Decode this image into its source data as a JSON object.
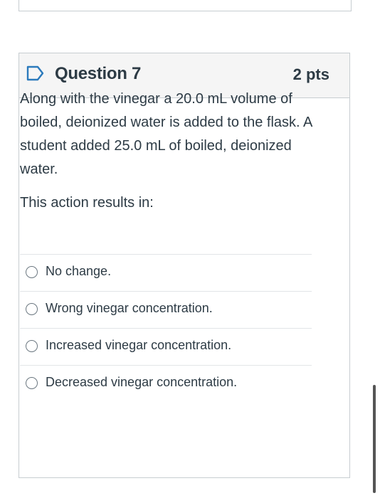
{
  "question": {
    "title": "Question 7",
    "points": "2 pts",
    "text": "Along with the vinegar a 20.0 mL volume of boiled, deionized water is added to the flask. A student added 25.0 mL of boiled, deionized water.",
    "prompt": "This action results in:",
    "answers": [
      {
        "label": "No change."
      },
      {
        "label": "Wrong vinegar concentration."
      },
      {
        "label": "Increased vinegar concentration."
      },
      {
        "label": "Decreased vinegar concentration."
      }
    ]
  },
  "icons": {
    "flag": "flag-question-icon"
  },
  "colors": {
    "header_bg": "#f5f5f5",
    "border": "#c7cdd1",
    "text": "#2d3b45",
    "flag": "#2b7abc"
  }
}
